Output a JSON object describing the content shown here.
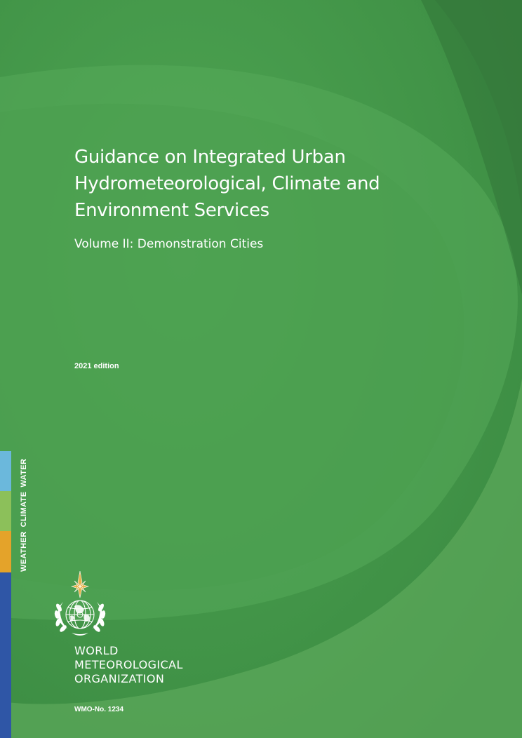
{
  "cover": {
    "title_lines": [
      "Guidance on Integrated Urban",
      "Hydrometeorological, Climate and",
      "Environment Services"
    ],
    "subtitle": "Volume II: Demonstration Cities",
    "edition": "2021 edition",
    "side_label": {
      "weather": "WEATHER",
      "climate": "CLIMATE",
      "water": "WATER"
    },
    "organization_lines": [
      "WORLD",
      "METEOROLOGICAL",
      "ORGANIZATION"
    ],
    "publication_number": "WMO-No. 1234",
    "emblem_icon": "wmo-emblem-icon"
  },
  "colors": {
    "background_green": "#3f8f45",
    "water_blue": "#6bb8dc",
    "climate_green": "#8cc05a",
    "weather_orange": "#e4a32a",
    "strip_blue": "#2f56a6",
    "emblem_star": "#e7b24a"
  }
}
